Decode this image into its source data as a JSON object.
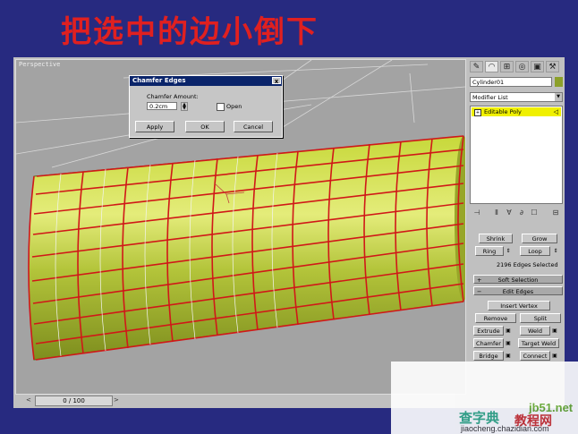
{
  "slide": {
    "title": "把选中的边小倒下"
  },
  "viewport": {
    "label": "Perspective"
  },
  "timeline": {
    "frame": "0 / 100",
    "left_arrow": "<",
    "right_arrow": ">"
  },
  "dialog": {
    "title": "Chamfer Edges",
    "close": "x",
    "amount_label": "Chamfer Amount:",
    "amount_value": "0.2cm",
    "open_label": "Open",
    "apply": "Apply",
    "ok": "OK",
    "cancel": "Cancel"
  },
  "panel": {
    "object_name": "Cylinder01",
    "modifier_list": "Modifier List",
    "stack_item": "Editable Poly",
    "selection": {
      "shrink": "Shrink",
      "grow": "Grow",
      "ring": "Ring",
      "loop": "Loop",
      "status": "2196 Edges Selected"
    },
    "soft_selection": "Soft Selection",
    "edit_edges": "Edit Edges",
    "insert_vertex": "Insert Vertex",
    "remove": "Remove",
    "split": "Split",
    "extrude": "Extrude",
    "weld": "Weld",
    "chamfer": "Chamfer",
    "target_weld": "Target Weld",
    "bridge": "Bridge",
    "connect": "Connect"
  },
  "watermark": {
    "site": "jb51.net",
    "sub1": "查字典",
    "sub2": "教程网",
    "url": "jiaocheng.chazidian.com"
  },
  "colors": {
    "background": "#272a80",
    "title": "#e02020",
    "mesh": "#d0e050",
    "edges": "#d01818"
  }
}
